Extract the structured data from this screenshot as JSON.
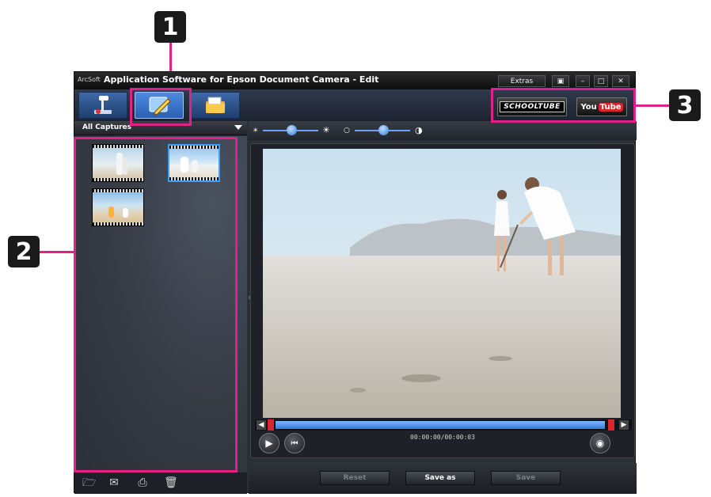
{
  "callouts": [
    "1",
    "2",
    "3"
  ],
  "window": {
    "brand": "ArcSoft",
    "title": "Application Software for Epson Document Camera - Edit",
    "extras_label": "Extras"
  },
  "upload": {
    "schooltube_label": "SCHOOLTUBE",
    "youtube_you": "You",
    "youtube_tube": "Tube"
  },
  "library": {
    "filter_label": "All Captures",
    "thumbnails": [
      {
        "name": "mother-child-walking",
        "selected": false
      },
      {
        "name": "family-beach-sitting",
        "selected": true
      },
      {
        "name": "kids-beach-play",
        "selected": false
      }
    ],
    "tools": [
      "open-folder-icon",
      "email-icon",
      "print-icon",
      "trash-icon"
    ]
  },
  "player": {
    "timecode": "00:00:00/00:00:03"
  },
  "actions": {
    "reset_label": "Reset",
    "save_as_label": "Save as",
    "save_label": "Save"
  },
  "colors": {
    "highlight": "#e0218a",
    "accent": "#3a78d8",
    "window_bg": "#2b2f36"
  }
}
